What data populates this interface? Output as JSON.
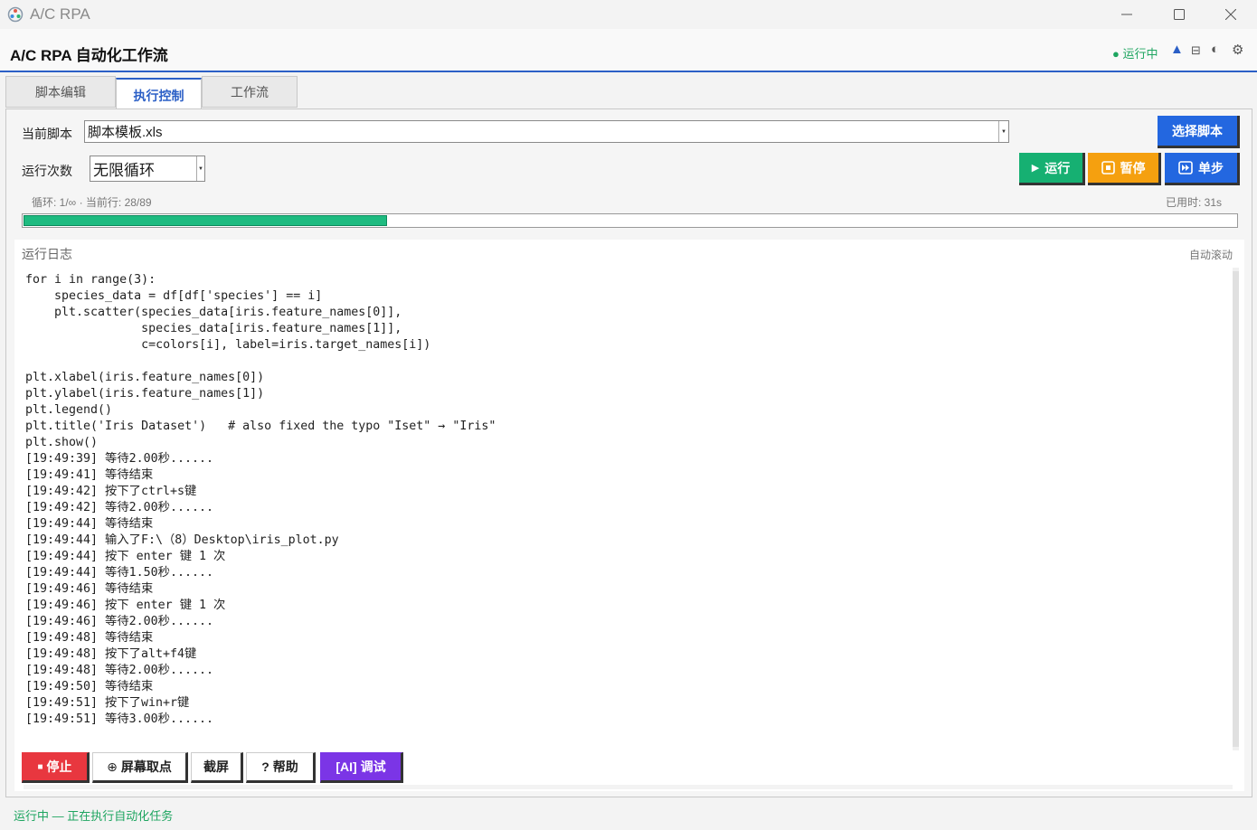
{
  "window": {
    "title": "A/C RPA"
  },
  "header": {
    "title": "A/C RPA 自动化工作流",
    "status": "运行中"
  },
  "tabs": [
    {
      "label": "脚本编辑",
      "active": false
    },
    {
      "label": "执行控制",
      "active": true
    },
    {
      "label": "工作流",
      "active": false
    }
  ],
  "control": {
    "script_label": "当前脚本",
    "script_value": "脚本模板.xls",
    "select_script": "选择脚本",
    "runs_label": "运行次数",
    "runs_value": "无限循环",
    "run": "运行",
    "pause": "暂停",
    "step": "单步",
    "loop_info": "循环: 1/∞ · 当前行: 28/89",
    "elapsed": "已用时: 31s",
    "progress": 0.3
  },
  "log": {
    "title": "运行日志",
    "autoscroll": "自动滚动",
    "lines": [
      "for i in range(3):",
      "    species_data = df[df['species'] == i]",
      "    plt.scatter(species_data[iris.feature_names[0]],",
      "                species_data[iris.feature_names[1]],",
      "                c=colors[i], label=iris.target_names[i])",
      "",
      "plt.xlabel(iris.feature_names[0])",
      "plt.ylabel(iris.feature_names[1])",
      "plt.legend()",
      "plt.title('Iris Dataset')   # also fixed the typo \"Iset\" → \"Iris\"",
      "plt.show()",
      "[19:49:39] 等待2.00秒......",
      "[19:49:41] 等待结束",
      "[19:49:42] 按下了ctrl+s键",
      "[19:49:42] 等待2.00秒......",
      "[19:49:44] 等待结束",
      "[19:49:44] 输入了F:\\（8）Desktop\\iris_plot.py",
      "[19:49:44] 按下 enter 键 1 次",
      "[19:49:44] 等待1.50秒......",
      "[19:49:46] 等待结束",
      "[19:49:46] 按下 enter 键 1 次",
      "[19:49:46] 等待2.00秒......",
      "[19:49:48] 等待结束",
      "[19:49:48] 按下了alt+f4键",
      "[19:49:48] 等待2.00秒......",
      "[19:49:50] 等待结束",
      "[19:49:51] 按下了win+r键",
      "[19:49:51] 等待3.00秒......"
    ]
  },
  "toolbar": {
    "stop": "停止",
    "screen_pick": "屏幕取点",
    "screenshot": "截屏",
    "help": "? 帮助",
    "ai_debug": "[AI] 调试"
  },
  "footer": {
    "status": "运行中 — 正在执行自动化任务"
  },
  "colors": {
    "accent": "#2b5fc6",
    "run": "#16b072",
    "pause": "#f5a00f",
    "step": "#2367e0",
    "stop": "#e8373f",
    "ai": "#7b35e6",
    "running_text": "#1ea560"
  }
}
